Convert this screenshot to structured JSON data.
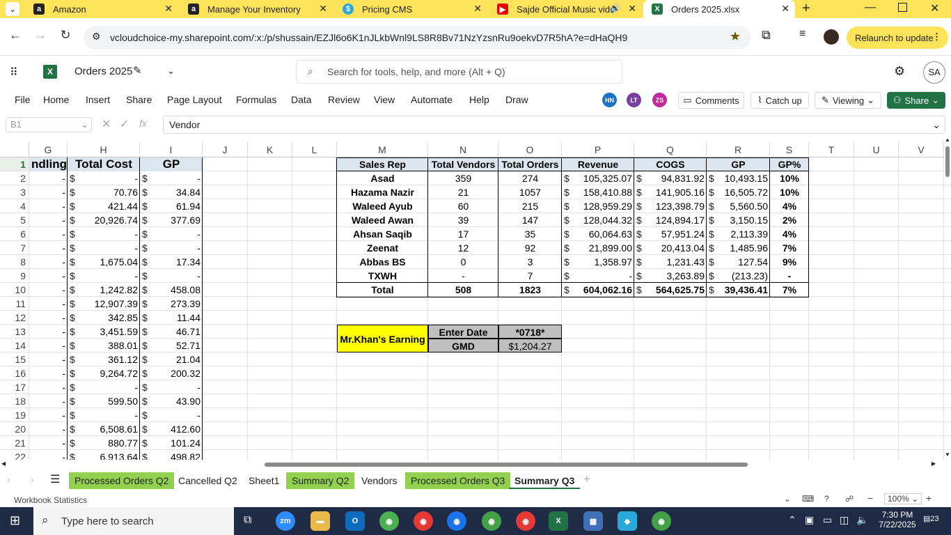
{
  "browser": {
    "tabs": [
      {
        "title": "Amazon",
        "icon": "amazon-icon"
      },
      {
        "title": "Manage Your Inventory",
        "icon": "amazon-icon"
      },
      {
        "title": "Pricing CMS",
        "icon": "dollar-icon"
      },
      {
        "title": "Sajde Official Music vide",
        "icon": "youtube-icon"
      },
      {
        "title": "Orders 2025.xlsx",
        "icon": "excel-icon"
      }
    ],
    "url": "vcloudchoice-my.sharepoint.com/:x:/p/shussain/EZJl6o6K1nJLkbWnl9LS8R8Bv71NzYzsnRu9oekvD7R5hA?e=dHaQH9",
    "relaunch": "Relaunch to update"
  },
  "excel": {
    "doc_title": "Orders 2025",
    "search_placeholder": "Search for tools, help, and more (Alt + Q)",
    "user_initials": "SA",
    "ribbon_tabs": [
      "File",
      "Home",
      "Insert",
      "Share",
      "Page Layout",
      "Formulas",
      "Data",
      "Review",
      "View",
      "Automate",
      "Help",
      "Draw"
    ],
    "collaborators": [
      "HN",
      "LT",
      "ZS"
    ],
    "comments": "Comments",
    "catchup": "Catch up",
    "viewing": "Viewing",
    "share": "Share",
    "name_box": "B1",
    "formula": "Vendor"
  },
  "columns": [
    "G",
    "H",
    "I",
    "J",
    "K",
    "L",
    "M",
    "N",
    "O",
    "P",
    "Q",
    "R",
    "S",
    "T",
    "U",
    "V"
  ],
  "rows": [
    "1",
    "2",
    "3",
    "4",
    "5",
    "6",
    "7",
    "8",
    "9",
    "10",
    "11",
    "12",
    "13",
    "14",
    "15",
    "16",
    "17",
    "18",
    "19",
    "20",
    "21",
    "22"
  ],
  "left_table": {
    "headers": [
      "ndling",
      "Total Cost",
      "GP"
    ],
    "rows": [
      [
        "-",
        "-",
        "-"
      ],
      [
        "-",
        "70.76",
        "34.84"
      ],
      [
        "-",
        "421.44",
        "61.94"
      ],
      [
        "-",
        "20,926.74",
        "377.69"
      ],
      [
        "-",
        "-",
        "-"
      ],
      [
        "-",
        "-",
        "-"
      ],
      [
        "-",
        "1,675.04",
        "17.34"
      ],
      [
        "-",
        "-",
        "-"
      ],
      [
        "-",
        "1,242.82",
        "458.08"
      ],
      [
        "-",
        "12,907.39",
        "273.39"
      ],
      [
        "-",
        "342.85",
        "11.44"
      ],
      [
        "-",
        "3,451.59",
        "46.71"
      ],
      [
        "-",
        "388.01",
        "52.71"
      ],
      [
        "-",
        "361.12",
        "21.04"
      ],
      [
        "-",
        "9,264.72",
        "200.32"
      ],
      [
        "-",
        "-",
        "-"
      ],
      [
        "-",
        "599.50",
        "43.90"
      ],
      [
        "-",
        "-",
        "-"
      ],
      [
        "-",
        "6,508.61",
        "412.60"
      ],
      [
        "-",
        "880.77",
        "101.24"
      ],
      [
        "-",
        "6,913.64",
        "498.82"
      ]
    ]
  },
  "summary_table": {
    "headers": [
      "Sales Rep",
      "Total Vendors",
      "Total Orders",
      "Revenue",
      "COGS",
      "GP",
      "GP%"
    ],
    "rows": [
      [
        "Asad",
        "359",
        "274",
        "105,325.07",
        "94,831.92",
        "10,493.15",
        "10%"
      ],
      [
        "Hazama Nazir",
        "21",
        "1057",
        "158,410.88",
        "141,905.16",
        "16,505.72",
        "10%"
      ],
      [
        "Waleed Ayub",
        "60",
        "215",
        "128,959.29",
        "123,398.79",
        "5,560.50",
        "4%"
      ],
      [
        "Waleed Awan",
        "39",
        "147",
        "128,044.32",
        "124,894.17",
        "3,150.15",
        "2%"
      ],
      [
        "Ahsan Saqib",
        "17",
        "35",
        "60,064.63",
        "57,951.24",
        "2,113.39",
        "4%"
      ],
      [
        "Zeenat",
        "12",
        "92",
        "21,899.00",
        "20,413.04",
        "1,485.96",
        "7%"
      ],
      [
        "Abbas BS",
        "0",
        "3",
        "1,358.97",
        "1,231.43",
        "127.54",
        "9%"
      ],
      [
        "TXWH",
        "-",
        "7",
        "-",
        "3,263.89",
        "(213.23)",
        "-"
      ],
      [
        "Total",
        "508",
        "1823",
        "604,062.16",
        "564,625.75",
        "39,436.41",
        "7%"
      ]
    ]
  },
  "earning_box": {
    "label": "Mr.Khan's Earning",
    "date_label": "Enter Date",
    "date_value": "*0718*",
    "gmd_label": "GMD",
    "gmd_value": "$1,204.27"
  },
  "currency": "$",
  "sheet_tabs": [
    "Processed Orders Q2",
    "Cancelled Q2",
    "Sheet1",
    "Summary Q2",
    "Vendors",
    "Processed Orders Q3",
    "Summary Q3"
  ],
  "status": {
    "left": "Workbook Statistics",
    "zoom": "100%"
  },
  "taskbar": {
    "search": "Type here to search",
    "time": "7:30 PM",
    "date": "7/22/2025",
    "notif": "23"
  },
  "colors": {
    "green_tab": "#92d050",
    "header_blue": "#dce6f1",
    "yellow": "#ffff00",
    "gray": "#bfbfbf",
    "excel_green": "#217346"
  }
}
